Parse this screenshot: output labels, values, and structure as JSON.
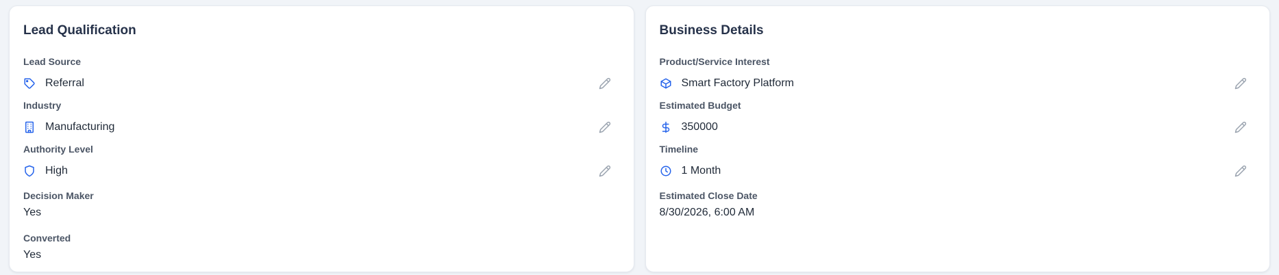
{
  "lead_qualification": {
    "title": "Lead Qualification",
    "fields": [
      {
        "label": "Lead Source",
        "value": "Referral",
        "icon": "tag-icon"
      },
      {
        "label": "Industry",
        "value": "Manufacturing",
        "icon": "building-icon"
      },
      {
        "label": "Authority Level",
        "value": "High",
        "icon": "shield-icon"
      }
    ],
    "decision_maker": {
      "label": "Decision Maker",
      "value": "Yes"
    },
    "converted": {
      "label": "Converted",
      "value": "Yes"
    }
  },
  "business_details": {
    "title": "Business Details",
    "fields": [
      {
        "label": "Product/Service Interest",
        "value": "Smart Factory Platform",
        "icon": "package-icon"
      },
      {
        "label": "Estimated Budget",
        "value": "350000",
        "icon": "dollar-icon"
      },
      {
        "label": "Timeline",
        "value": "1 Month",
        "icon": "clock-icon"
      }
    ],
    "close_date": {
      "label": "Estimated Close Date",
      "value": "8/30/2026, 6:00 AM"
    }
  },
  "colors": {
    "accent": "#2563eb",
    "edit_icon": "#9aa3af",
    "label": "#4b5565",
    "title": "#26324a",
    "background": "#f1f4f8",
    "card": "#ffffff"
  }
}
